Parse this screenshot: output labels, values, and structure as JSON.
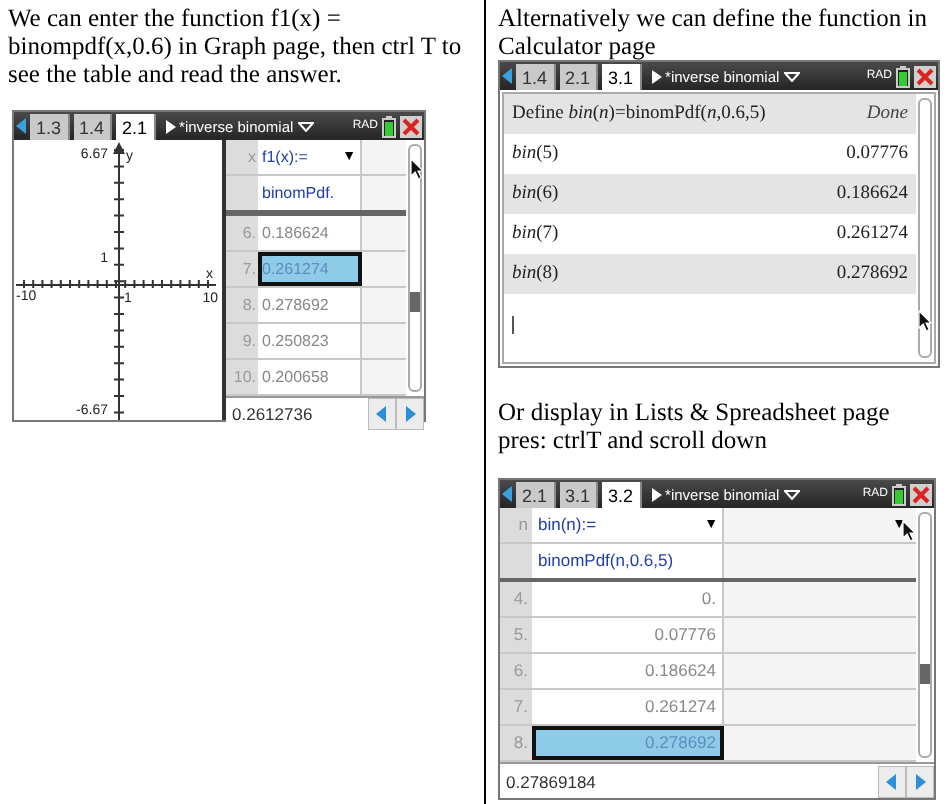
{
  "left": {
    "paragraph": "We can enter the function f1(x) = binompdf(x,0.6) in Graph page, then ctrl T to see the table and read the answer.",
    "graph_screen": {
      "tabs": [
        {
          "label": "1.3",
          "selected": false
        },
        {
          "label": "1.4",
          "selected": false
        },
        {
          "label": "2.1",
          "selected": true
        }
      ],
      "doc_title": "*inverse binomial",
      "mode": "RAD",
      "axis_labels": {
        "y_max": "6.67",
        "y_name": "y",
        "y_tick": "1",
        "x_min": "-10",
        "x_tick": "1",
        "x_max": "10",
        "x_name": "x",
        "y_min": "-6.67"
      },
      "table": {
        "column_label": "x",
        "header": "f1(x):=",
        "menu": "▼",
        "formula": "binomPdf.",
        "rows": [
          {
            "n": "6.",
            "value": "0.186624",
            "selected": false
          },
          {
            "n": "7.",
            "value": "0.261274",
            "selected": true
          },
          {
            "n": "8.",
            "value": "0.278692",
            "selected": false
          },
          {
            "n": "9.",
            "value": "0.250823",
            "selected": false
          },
          {
            "n": "10.",
            "value": "0.200658",
            "selected": false
          }
        ]
      },
      "entry": "0.2612736"
    }
  },
  "right": {
    "paragraph_1": "Alternatively we can define the function in Calculator page",
    "calculator_screen": {
      "tabs": [
        {
          "label": "1.4",
          "selected": false
        },
        {
          "label": "2.1",
          "selected": false
        },
        {
          "label": "3.1",
          "selected": true
        }
      ],
      "doc_title": "*inverse binomial",
      "mode": "RAD",
      "entries": [
        {
          "kind": "definition",
          "input": "Define *bin*(*n*)=binomPdf(*n*,0.6,5)",
          "result": "Done"
        },
        {
          "kind": "evaluation",
          "input": "*bin*(5)",
          "result": "0.07776"
        },
        {
          "kind": "evaluation",
          "input": "*bin*(6)",
          "result": "0.186624"
        },
        {
          "kind": "evaluation",
          "input": "*bin*(7)",
          "result": "0.261274"
        },
        {
          "kind": "evaluation",
          "input": "*bin*(8)",
          "result": "0.278692"
        }
      ]
    },
    "paragraph_2": "Or display in Lists & Spreadsheet page pres: ctrlT and scroll down",
    "spreadsheet_screen": {
      "tabs": [
        {
          "label": "2.1",
          "selected": false
        },
        {
          "label": "3.1",
          "selected": false
        },
        {
          "label": "3.2",
          "selected": true
        }
      ],
      "doc_title": "*inverse binomial",
      "mode": "RAD",
      "column_label": "n",
      "header": "bin(n):=",
      "menu_a": "▼",
      "menu_b": "▼",
      "formula": "binomPdf(n,0.6,5)",
      "rows": [
        {
          "n": "4.",
          "value": "0.",
          "selected": false
        },
        {
          "n": "5.",
          "value": "0.07776",
          "selected": false
        },
        {
          "n": "6.",
          "value": "0.186624",
          "selected": false
        },
        {
          "n": "7.",
          "value": "0.261274",
          "selected": false
        },
        {
          "n": "8.",
          "value": "0.278692",
          "selected": true
        }
      ],
      "entry": "0.27869184"
    }
  }
}
